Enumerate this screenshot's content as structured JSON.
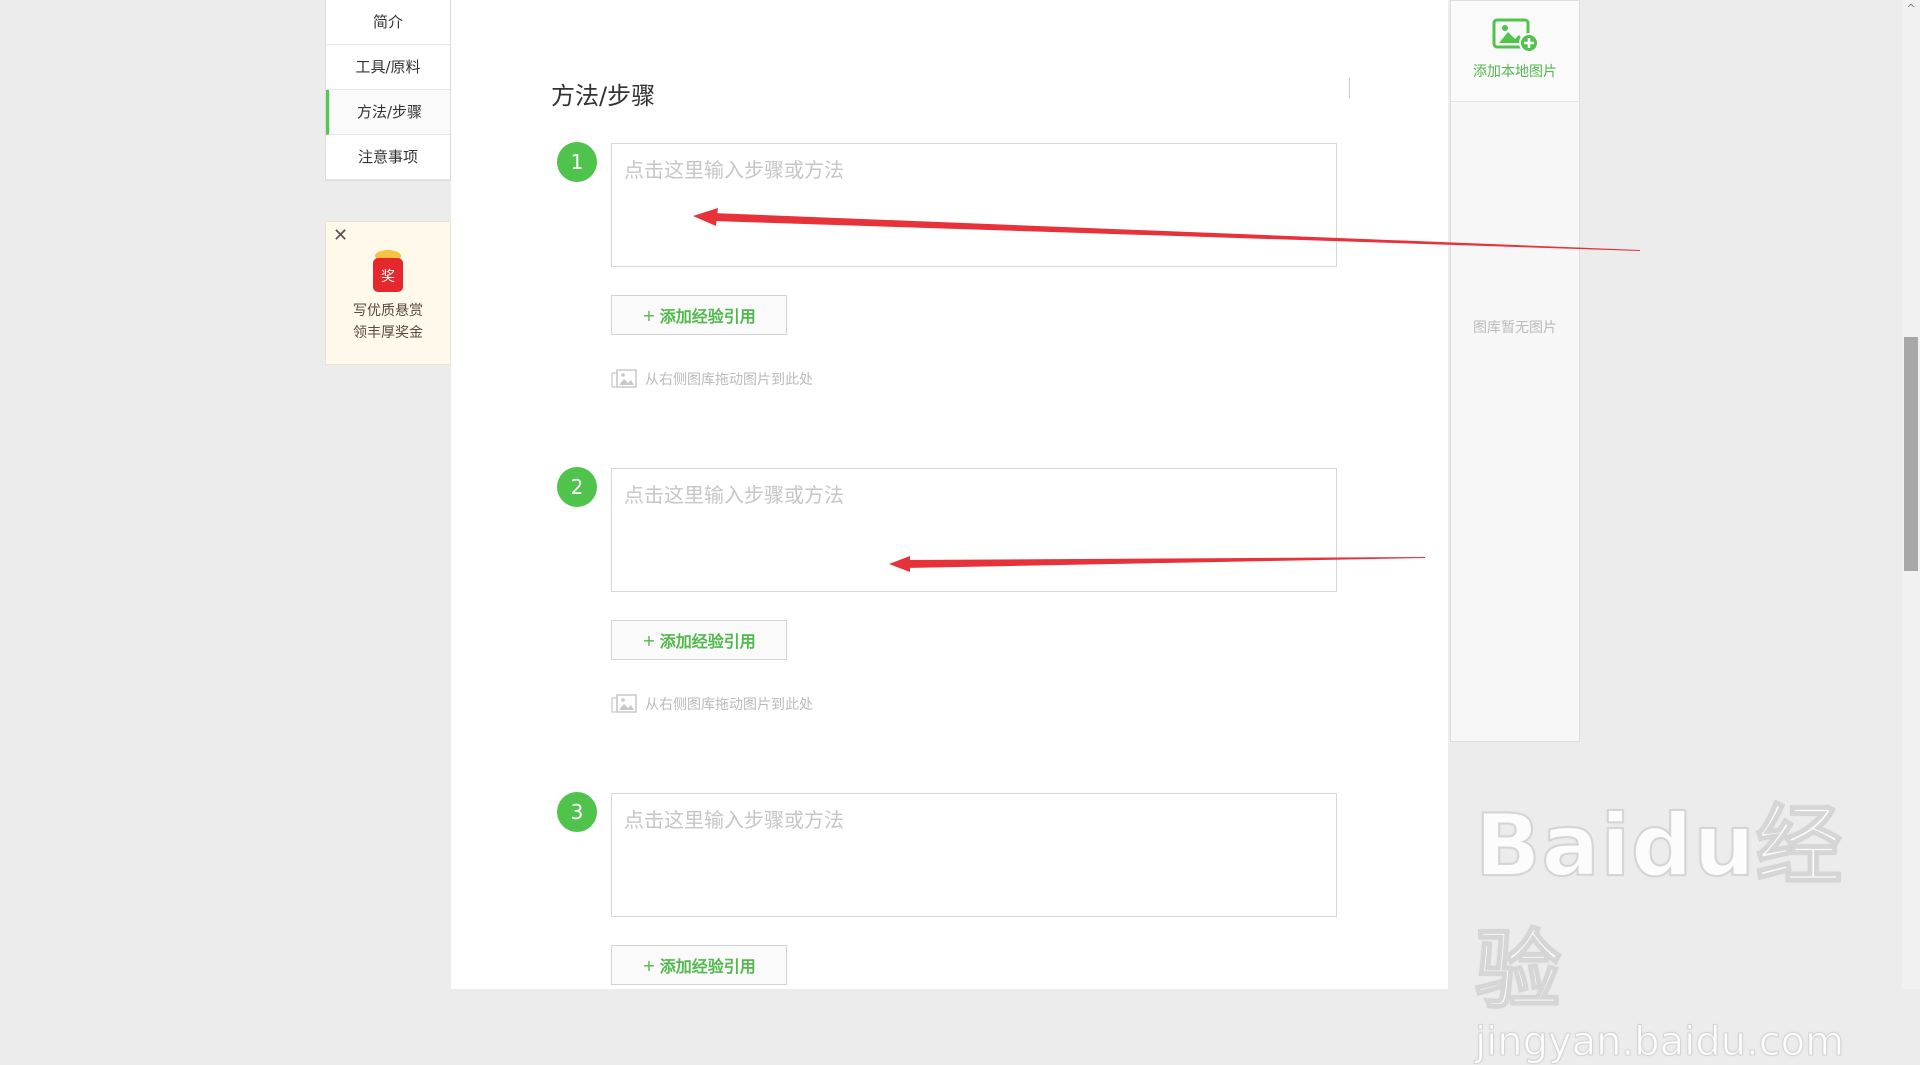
{
  "nav": {
    "items": [
      {
        "label": "简介"
      },
      {
        "label": "工具/原料"
      },
      {
        "label": "方法/步骤"
      },
      {
        "label": "注意事项"
      }
    ],
    "active_index": 2
  },
  "reward": {
    "line1": "写优质悬赏",
    "line2": "领丰厚奖金",
    "badge": "奖"
  },
  "section": {
    "title": "方法/步骤"
  },
  "steps": [
    {
      "number": "1",
      "placeholder": "点击这里输入步骤或方法",
      "value": "",
      "ref_label": "添加经验引用",
      "drag_hint": "从右侧图库拖动图片到此处"
    },
    {
      "number": "2",
      "placeholder": "点击这里输入步骤或方法",
      "value": "",
      "ref_label": "添加经验引用",
      "drag_hint": "从右侧图库拖动图片到此处"
    },
    {
      "number": "3",
      "placeholder": "点击这里输入步骤或方法",
      "value": "",
      "ref_label": "添加经验引用"
    }
  ],
  "gallery": {
    "add_label": "添加本地图片",
    "empty_text": "图库暂无图片"
  },
  "watermark": {
    "brand": "Baidu经验",
    "url": "jingyan.baidu.com"
  },
  "colors": {
    "accent": "#4fc34c",
    "arrow": "#e8323a"
  }
}
